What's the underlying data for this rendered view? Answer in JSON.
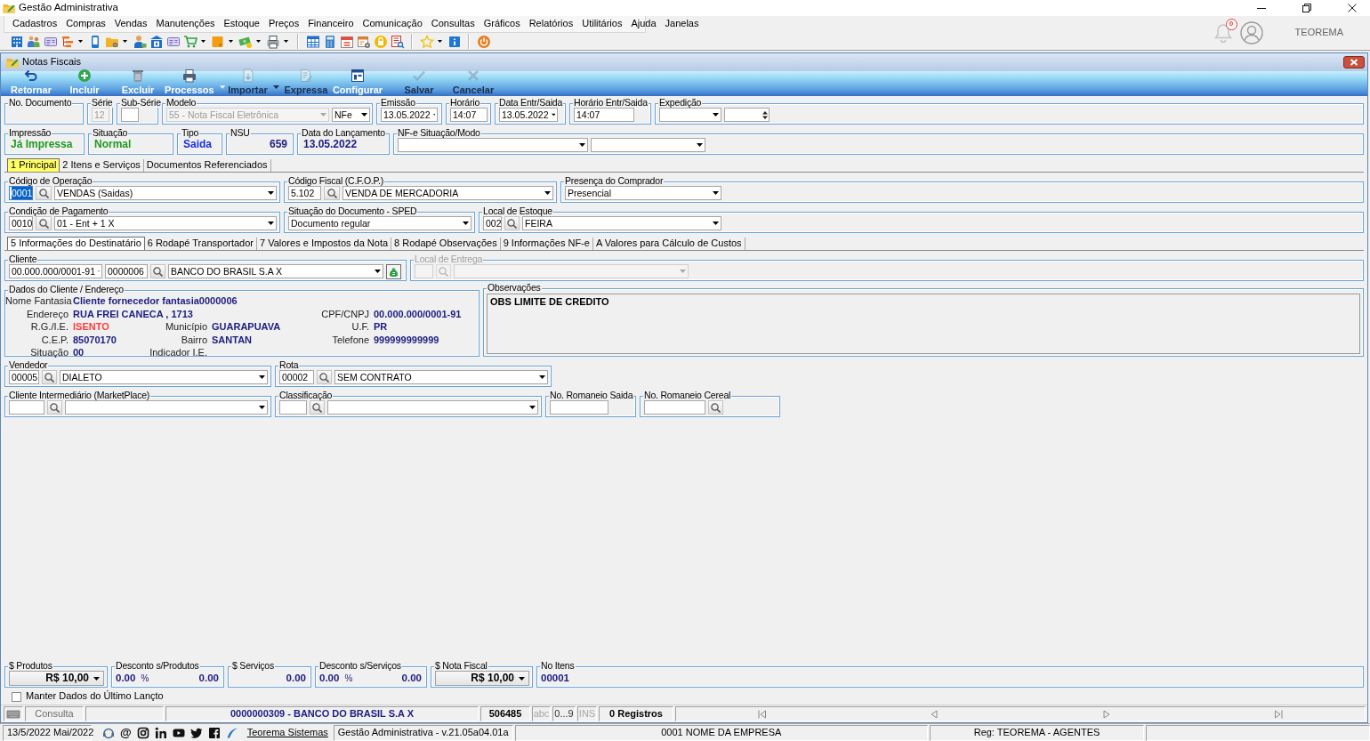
{
  "window": {
    "title": "Gestão Administrativa"
  },
  "menu": [
    "Cadastros",
    "Compras",
    "Vendas",
    "Manutenções",
    "Estoque",
    "Preços",
    "Financeiro",
    "Comunicação",
    "Consultas",
    "Gráficos",
    "Relatórios",
    "Utilitários",
    "Ajuda",
    "Janelas"
  ],
  "user_area": {
    "notification_count": "0",
    "user_name": "TEOREMA"
  },
  "child_window": {
    "title": "Notas Fiscais"
  },
  "actions": [
    {
      "label": "Retornar",
      "disabled": false,
      "dropdown": false
    },
    {
      "label": "Incluir",
      "disabled": false,
      "dropdown": false
    },
    {
      "label": "Excluir",
      "disabled": false,
      "dropdown": false
    },
    {
      "label": "Processos",
      "disabled": false,
      "dropdown": true
    },
    {
      "label": "Importar",
      "disabled": true,
      "dropdown": true
    },
    {
      "label": "Expressa",
      "disabled": true,
      "dropdown": false
    },
    {
      "label": "Configurar",
      "disabled": false,
      "dropdown": false
    },
    {
      "label": "Salvar",
      "disabled": true,
      "dropdown": false
    },
    {
      "label": "Cancelar",
      "disabled": true,
      "dropdown": false
    }
  ],
  "header_rows": [
    {
      "groups": [
        {
          "label": "No. Documento",
          "disabled": false
        },
        {
          "label": "Série",
          "disabled": false,
          "fields": [
            {
              "kind": "input",
              "value": "12",
              "disabled": true,
              "focused": false
            }
          ]
        },
        {
          "label": "Sub-Série",
          "disabled": false,
          "fields": [
            {
              "kind": "input",
              "disabled": false,
              "focused": false
            }
          ]
        },
        {
          "label": "Modelo",
          "disabled": false,
          "fields": [
            {
              "kind": "combo",
              "value": "55 - Nota Fiscal Eletrônica",
              "disabled": true
            },
            {
              "kind": "combo",
              "value": "NFe",
              "disabled": false
            }
          ]
        },
        {
          "label": "Emissão",
          "disabled": false,
          "fields": [
            {
              "kind": "combo",
              "value": "13.05.2022",
              "disabled": false
            }
          ]
        },
        {
          "label": "Horário",
          "disabled": false,
          "fields": [
            {
              "kind": "input",
              "value": "14:07",
              "disabled": false,
              "focused": false
            }
          ]
        },
        {
          "label": "Data Entr/Saida",
          "disabled": false,
          "fields": [
            {
              "kind": "combo",
              "value": "13.05.2022",
              "disabled": false
            }
          ]
        },
        {
          "label": "Horário Entr/Saida",
          "disabled": false,
          "fields": [
            {
              "kind": "input",
              "value": "14:07",
              "disabled": false,
              "focused": false
            }
          ]
        },
        {
          "label": "Expedição",
          "disabled": false,
          "fields": [
            {
              "kind": "combo",
              "disabled": false
            },
            {
              "kind": "spin",
              "disabled": false
            }
          ]
        }
      ]
    },
    {
      "groups": [
        {
          "label": "Impressão",
          "disabled": false,
          "fields": [
            {
              "kind": "text",
              "value": "Já Impressa",
              "color": "#1f9a1f"
            }
          ]
        },
        {
          "label": "Situação",
          "disabled": false,
          "fields": [
            {
              "kind": "text",
              "value": "Normal",
              "color": "#1f9a1f"
            }
          ]
        },
        {
          "label": "Tipo",
          "disabled": false,
          "fields": [
            {
              "kind": "text",
              "value": "Saida",
              "color": "#1a2ee6"
            }
          ]
        },
        {
          "label": "NSU",
          "disabled": false,
          "fields": [
            {
              "kind": "number",
              "value": "659",
              "color": "#1c1c80"
            }
          ]
        },
        {
          "label": "Data do Lançamento",
          "disabled": false,
          "fields": [
            {
              "kind": "text",
              "value": "13.05.2022",
              "color": "#1c1c80"
            }
          ]
        },
        {
          "label": "NF-e Situação/Modo",
          "disabled": false,
          "fields": [
            {
              "kind": "combo",
              "disabled": false
            },
            {
              "kind": "combo",
              "disabled": false
            }
          ]
        }
      ]
    }
  ],
  "main_tabs": [
    {
      "label": "1 Principal",
      "selected": true
    },
    {
      "label": "2 Itens e Serviços",
      "selected": false
    },
    {
      "label": "Documentos Referenciados",
      "selected": false
    }
  ],
  "principal_rows": [
    {
      "groups": [
        {
          "label": "Código de Operação",
          "disabled": false,
          "fields": [
            {
              "kind": "input",
              "value": "0001",
              "disabled": false,
              "focused": true
            },
            {
              "kind": "search",
              "disabled": false
            },
            {
              "kind": "combo",
              "value": "VENDAS (Saidas)",
              "disabled": false
            }
          ]
        },
        {
          "label": "Código Fiscal (C.F.O.P.)",
          "disabled": false,
          "fields": [
            {
              "kind": "input",
              "value": "5.102",
              "disabled": false,
              "focused": false
            },
            {
              "kind": "search",
              "disabled": false
            },
            {
              "kind": "combo",
              "value": "VENDA DE MERCADORIA",
              "disabled": false
            }
          ]
        },
        {
          "label": "Presença do Comprador",
          "disabled": false,
          "fields": [
            {
              "kind": "combo",
              "value": "Presencial",
              "disabled": false
            }
          ]
        }
      ]
    },
    {
      "groups": [
        {
          "label": "Condição de Pagamento",
          "disabled": false,
          "fields": [
            {
              "kind": "input",
              "value": "0010",
              "disabled": false,
              "focused": false
            },
            {
              "kind": "search",
              "disabled": false
            },
            {
              "kind": "combo",
              "value": "01 - Ent + 1 X",
              "disabled": false
            }
          ]
        },
        {
          "label": "Situação do Documento - SPED",
          "disabled": false,
          "fields": [
            {
              "kind": "combo",
              "value": "Documento regular",
              "disabled": false
            }
          ]
        },
        {
          "label": "Local de Estoque",
          "disabled": false,
          "fields": [
            {
              "kind": "input",
              "value": "002",
              "disabled": false,
              "focused": false
            },
            {
              "kind": "search",
              "disabled": false
            },
            {
              "kind": "combo",
              "value": "FEIRA",
              "disabled": false
            }
          ]
        }
      ]
    }
  ],
  "detail_tabs": [
    {
      "label": "5 Informações do Destinatário",
      "selected": true
    },
    {
      "label": "6 Rodapé Transportador",
      "selected": false
    },
    {
      "label": "7 Valores e Impostos da Nota",
      "selected": false
    },
    {
      "label": "8 Rodapé Observações",
      "selected": false
    },
    {
      "label": "9 Informações NF-e",
      "selected": false
    },
    {
      "label": "A Valores para Cálculo de Custos",
      "selected": false
    }
  ],
  "client_row": {
    "groups": [
      {
        "label": "Cliente",
        "disabled": false,
        "fields": [
          {
            "kind": "combo",
            "value": "00.000.000/0001-91",
            "disabled": false
          },
          {
            "kind": "input",
            "value": "0000006",
            "disabled": false,
            "focused": false
          },
          {
            "kind": "search",
            "disabled": false
          },
          {
            "kind": "combo",
            "value": "BANCO DO BRASIL S.A X",
            "disabled": false
          },
          {
            "kind": "action",
            "disabled": false
          }
        ]
      },
      {
        "label": "Local de Entrega",
        "disabled": true,
        "fields": [
          {
            "kind": "input",
            "disabled": true,
            "focused": false
          },
          {
            "kind": "search",
            "disabled": true
          },
          {
            "kind": "combo",
            "disabled": true
          }
        ]
      }
    ]
  },
  "client_details": {
    "label": "Dados do Cliente / Endereço",
    "rows": [
      [
        {
          "label": "Nome Fantasia",
          "value": "Cliente fornecedor fantasia0000006",
          "color": "#1c1c80"
        }
      ],
      [
        {
          "label": "Endereço",
          "value": "RUA FREI CANECA , 1713",
          "color": "#1c1c80"
        },
        null,
        {
          "label": "CPF/CNPJ",
          "value": "00.000.000/0001-91",
          "color": "#1c1c80"
        }
      ],
      [
        {
          "label": "R.G./I.E.",
          "value": "ISENTO",
          "color": "#ff3b3b"
        },
        {
          "label": "Município",
          "value": "GUARAPUAVA",
          "color": "#1c1c80"
        },
        {
          "label": "U.F.",
          "value": "PR",
          "color": "#1c1c80"
        }
      ],
      [
        {
          "label": "C.E.P.",
          "value": "85070170",
          "color": "#1c1c80"
        },
        {
          "label": "Bairro",
          "value": "SANTAN",
          "color": "#1c1c80"
        },
        {
          "label": "Telefone",
          "value": "999999999999",
          "color": "#1c1c80"
        }
      ],
      [
        {
          "label": "Situação",
          "value": "00",
          "color": "#1c1c80"
        },
        {
          "label": "Indicador I.E."
        }
      ]
    ]
  },
  "observations": {
    "label": "Observações",
    "text": "OBS LIMITE DE CREDITO"
  },
  "lower_rows": [
    {
      "groups": [
        {
          "label": "Vendedor",
          "disabled": false,
          "fields": [
            {
              "kind": "input",
              "value": "00005",
              "disabled": false,
              "focused": false
            },
            {
              "kind": "search",
              "disabled": false
            },
            {
              "kind": "combo",
              "value": "DIALETO",
              "disabled": false
            }
          ]
        },
        {
          "label": "Rota",
          "disabled": false,
          "fields": [
            {
              "kind": "input",
              "value": "00002",
              "disabled": false,
              "focused": false
            },
            {
              "kind": "search",
              "disabled": false
            },
            {
              "kind": "combo",
              "value": "SEM CONTRATO",
              "disabled": false
            }
          ]
        }
      ]
    },
    {
      "groups": [
        {
          "label": "Cliente Intermediário (MarketPlace)",
          "disabled": false,
          "fields": [
            {
              "kind": "input",
              "disabled": false,
              "focused": false
            },
            {
              "kind": "search",
              "disabled": false
            },
            {
              "kind": "combo",
              "disabled": false
            }
          ]
        },
        {
          "label": "Classificação",
          "disabled": false,
          "fields": [
            {
              "kind": "input",
              "disabled": false,
              "focused": false
            },
            {
              "kind": "search",
              "disabled": false
            },
            {
              "kind": "combo",
              "disabled": false
            }
          ]
        },
        {
          "label": "No. Romaneio Saida",
          "disabled": false,
          "fields": [
            {
              "kind": "input",
              "disabled": false,
              "focused": false
            }
          ]
        },
        {
          "label": "No. Romaneio Cereal",
          "disabled": false,
          "fields": [
            {
              "kind": "input",
              "disabled": false,
              "focused": false
            },
            {
              "kind": "search",
              "disabled": false
            }
          ]
        }
      ]
    }
  ],
  "totals": [
    {
      "label": "$ Produtos",
      "kind": "amount_select",
      "value": "R$ 10,00"
    },
    {
      "label": "Desconto s/Produtos",
      "kind": "discount",
      "percent": "0.00",
      "percent_sign": "%",
      "value": "0.00"
    },
    {
      "label": "$ Serviços",
      "kind": "amount",
      "value": "0.00"
    },
    {
      "label": "Desconto s/Serviços",
      "kind": "discount",
      "percent": "0.00",
      "percent_sign": "%",
      "value": "0.00"
    },
    {
      "label": "$ Nota Fiscal",
      "kind": "amount_select",
      "value": "R$ 10,00"
    },
    {
      "label": "No Itens",
      "kind": "count",
      "value": "00001"
    }
  ],
  "keep_last_entry": {
    "label": "Manter Dados do Último Lançto",
    "checked": false
  },
  "record_bar": {
    "mode": "Consulta",
    "record": "0000000309 - BANCO DO BRASIL S.A X",
    "code": "506485",
    "indicators": [
      {
        "label": "abc",
        "on": false
      },
      {
        "label": "0...9",
        "on": true
      },
      {
        "label": "INS",
        "on": false
      }
    ],
    "count": "0 Registros"
  },
  "status_bar": {
    "date": "13/5/2022 Mai/2022",
    "email_symbol": "@",
    "link": "Teorema Sistemas",
    "version": "Gestão Administrativa - v.21.05a04.01a",
    "company": "0001 NOME DA EMPRESA",
    "registration": "Reg: TEOREMA - AGENTES"
  }
}
